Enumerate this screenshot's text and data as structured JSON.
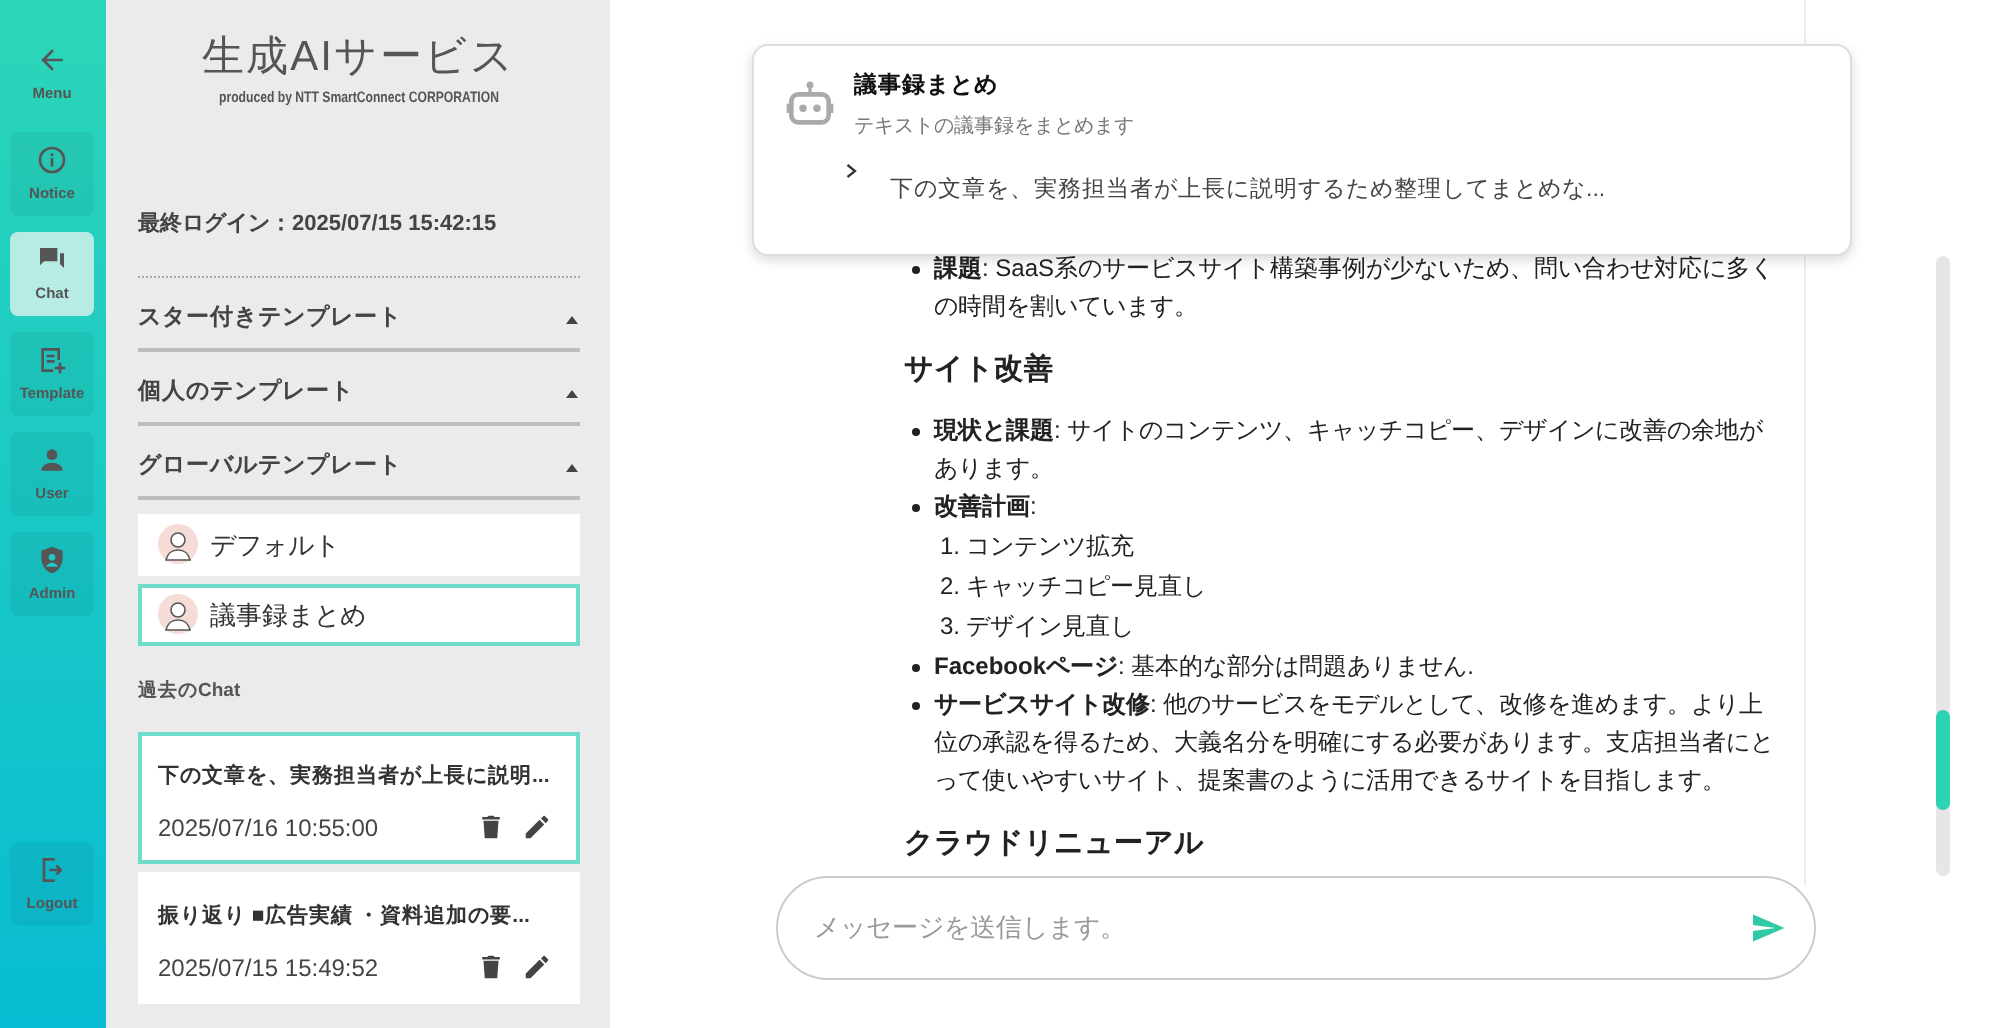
{
  "rail": {
    "items": [
      {
        "label": "Menu",
        "kind": "menu",
        "selected": false
      },
      {
        "label": "Notice",
        "kind": "notice",
        "selected": false
      },
      {
        "label": "Chat",
        "kind": "chat",
        "selected": true
      },
      {
        "label": "Template",
        "kind": "template",
        "selected": false
      },
      {
        "label": "User",
        "kind": "user",
        "selected": false
      },
      {
        "label": "Admin",
        "kind": "admin",
        "selected": false
      }
    ],
    "logout": {
      "label": "Logout",
      "kind": "logout"
    }
  },
  "sidebar": {
    "title": "生成AIサービス",
    "subtitle": "produced by NTT SmartConnect CORPORATION",
    "last_login": "最終ログイン：2025/07/15 15:42:15",
    "sections": [
      {
        "label": "スター付きテンプレート",
        "expanded": true
      },
      {
        "label": "個人のテンプレート",
        "expanded": true
      },
      {
        "label": "グローバルテンプレート",
        "expanded": true
      }
    ],
    "templates": [
      {
        "label": "デフォルト",
        "selected": false
      },
      {
        "label": "議事録まとめ",
        "selected": true
      }
    ],
    "history_heading": "過去のChat",
    "history": [
      {
        "title": "下の文章を、実務担当者が上長に説明...",
        "time": "2025/07/16 10:55:00",
        "selected": true
      },
      {
        "title": "振り返り ■広告実績 ・資料追加の要...",
        "time": "2025/07/15 15:49:52",
        "selected": false
      }
    ]
  },
  "template_popup": {
    "title": "議事録まとめ",
    "description": "テキストの議事録をまとめます",
    "prompt": "下の文章を、実務担当者が上長に説明するため整理してまとめな..."
  },
  "message": [
    {
      "kind": "bullet",
      "text": "**課題**: SaaS系のサービスサイト構築事例が少ないため、問い合わせ対応に多くの時間を割いています。"
    },
    {
      "kind": "heading",
      "text": "サイト改善"
    },
    {
      "kind": "bullet",
      "text": "**現状と課題**: サイトのコンテンツ、キャッチコピー、デザインに改善の余地があります。"
    },
    {
      "kind": "bullet",
      "text": "**改善計画**:",
      "children": [
        {
          "number": "1.",
          "text": "コンテンツ拡充"
        },
        {
          "number": "2.",
          "text": "キャッチコピー見直し"
        },
        {
          "number": "3.",
          "text": "デザイン見直し"
        }
      ]
    },
    {
      "kind": "bullet",
      "text": "**Facebookページ**: 基本的な部分は問題ありません."
    },
    {
      "kind": "bullet",
      "text": "**サービスサイト改修**: 他のサービスをモデルとして、改修を進めます。より上位の承認を得るため、大義名分を明確にする必要があります。支店担当者にとって使いやすいサイト、提案書のように活用できるサイトを目指します。"
    },
    {
      "kind": "heading",
      "text": "クラウドリニューアル"
    }
  ],
  "composer": {
    "placeholder": "メッセージを送信します。"
  }
}
